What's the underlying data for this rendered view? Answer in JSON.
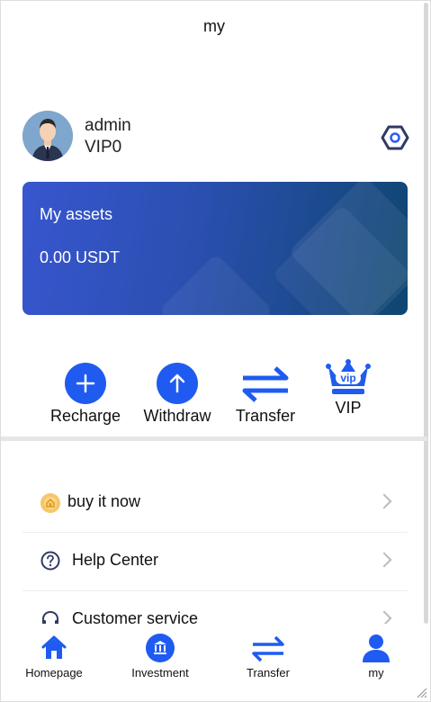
{
  "header": {
    "title": "my"
  },
  "profile": {
    "username": "admin",
    "vip_level": "VIP0"
  },
  "assets": {
    "title": "My assets",
    "value": "0.00 USDT"
  },
  "actions": [
    {
      "label": "Recharge",
      "icon": "plus-circle-icon"
    },
    {
      "label": "Withdraw",
      "icon": "arrow-up-circle-icon"
    },
    {
      "label": "Transfer",
      "icon": "transfer-arrows-icon"
    },
    {
      "label": "VIP",
      "icon": "vip-crown-icon"
    }
  ],
  "menu": [
    {
      "label": "buy it now",
      "icon": "coin-icon"
    },
    {
      "label": "Help Center",
      "icon": "question-circle-icon"
    },
    {
      "label": "Customer service",
      "icon": "headset-icon"
    }
  ],
  "tabbar": [
    {
      "label": "Homepage",
      "icon": "home-icon"
    },
    {
      "label": "Investment",
      "icon": "bank-icon"
    },
    {
      "label": "Transfer",
      "icon": "transfer-arrows-icon"
    },
    {
      "label": "my",
      "icon": "user-icon"
    }
  ],
  "colors": {
    "accent": "#1f5bf0",
    "card_start": "#3856cf",
    "card_end": "#0f4670"
  }
}
